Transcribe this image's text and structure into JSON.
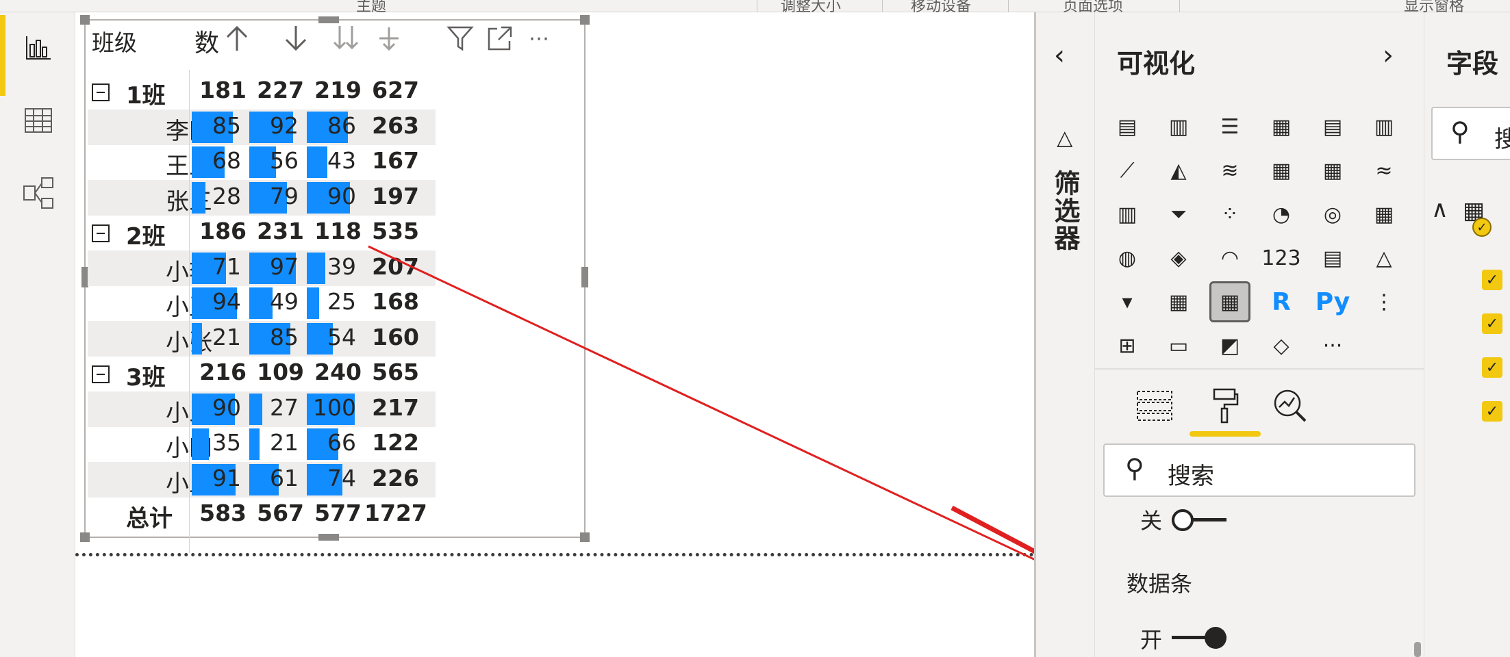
{
  "ribbon": {
    "labels": [
      "主题",
      "调整大小",
      "移动设备",
      "页面选项",
      "显示窗格"
    ]
  },
  "left_nav": {
    "items": [
      {
        "name": "report-view",
        "icon": "bar-chart-icon",
        "active": true
      },
      {
        "name": "data-view",
        "icon": "table-grid-icon",
        "active": false
      },
      {
        "name": "model-view",
        "icon": "model-icon",
        "active": false
      }
    ]
  },
  "matrix": {
    "header": {
      "class_col": "班级",
      "cut_col": "数"
    },
    "groups": [
      {
        "name": "1班",
        "totals": [
          "181",
          "227",
          "219",
          "627"
        ],
        "rows": [
          {
            "name": "李四",
            "values": [
              85,
              92,
              86
            ],
            "total": "263"
          },
          {
            "name": "王五",
            "values": [
              68,
              56,
              43
            ],
            "total": "167"
          },
          {
            "name": "张三",
            "values": [
              28,
              79,
              90
            ],
            "total": "197"
          }
        ]
      },
      {
        "name": "2班",
        "totals": [
          "186",
          "231",
          "118",
          "535"
        ],
        "rows": [
          {
            "name": "小李",
            "values": [
              71,
              97,
              39
            ],
            "total": "207"
          },
          {
            "name": "小王",
            "values": [
              94,
              49,
              25
            ],
            "total": "168"
          },
          {
            "name": "小张",
            "values": [
              21,
              85,
              54
            ],
            "total": "160"
          }
        ]
      },
      {
        "name": "3班",
        "totals": [
          "216",
          "109",
          "240",
          "565"
        ],
        "rows": [
          {
            "name": "小三",
            "values": [
              90,
              27,
              100
            ],
            "total": "217"
          },
          {
            "name": "小四",
            "values": [
              35,
              21,
              66
            ],
            "total": "122"
          },
          {
            "name": "小五",
            "values": [
              91,
              61,
              74
            ],
            "total": "226"
          }
        ]
      }
    ],
    "grand_total": {
      "label": "总计",
      "values": [
        "583",
        "567",
        "577",
        "1727"
      ]
    },
    "data_bar_color": "#118dff",
    "data_bar_max": 100
  },
  "filter_pane": {
    "label": "筛选器"
  },
  "viz_pane": {
    "title": "可视化",
    "search_placeholder": "搜索",
    "toggle_off_label": "关",
    "section_title": "数据条",
    "toggle_on_label": "开",
    "icons": [
      {
        "name": "stacked-bar-icon",
        "g": "▤"
      },
      {
        "name": "stacked-column-icon",
        "g": "▥"
      },
      {
        "name": "clustered-bar-icon",
        "g": "☰"
      },
      {
        "name": "clustered-column-icon",
        "g": "▦"
      },
      {
        "name": "100-stacked-bar-icon",
        "g": "▤"
      },
      {
        "name": "100-stacked-column-icon",
        "g": "▥"
      },
      {
        "name": "line-chart-icon",
        "g": "⟋"
      },
      {
        "name": "area-chart-icon",
        "g": "◭"
      },
      {
        "name": "stacked-area-icon",
        "g": "≋"
      },
      {
        "name": "line-column-icon",
        "g": "▦"
      },
      {
        "name": "line-clustered-column-icon",
        "g": "▦"
      },
      {
        "name": "ribbon-chart-icon",
        "g": "≈"
      },
      {
        "name": "waterfall-icon",
        "g": "▥"
      },
      {
        "name": "funnel-icon",
        "g": "⏷"
      },
      {
        "name": "scatter-icon",
        "g": "⁘"
      },
      {
        "name": "pie-chart-icon",
        "g": "◔"
      },
      {
        "name": "donut-chart-icon",
        "g": "◎"
      },
      {
        "name": "treemap-icon",
        "g": "▦"
      },
      {
        "name": "map-icon",
        "g": "◍"
      },
      {
        "name": "filled-map-icon",
        "g": "◈"
      },
      {
        "name": "gauge-icon",
        "g": "◠"
      },
      {
        "name": "card-icon",
        "g": "123"
      },
      {
        "name": "multirow-card-icon",
        "g": "▤"
      },
      {
        "name": "kpi-icon",
        "g": "△"
      },
      {
        "name": "slicer-icon",
        "g": "▾"
      },
      {
        "name": "table-icon",
        "g": "▦"
      },
      {
        "name": "matrix-icon",
        "g": "▦",
        "selected": true
      },
      {
        "name": "r-visual-icon",
        "g": "R",
        "text": true
      },
      {
        "name": "python-visual-icon",
        "g": "Py",
        "text": true
      },
      {
        "name": "key-influencers-icon",
        "g": "⋮"
      },
      {
        "name": "decomposition-tree-icon",
        "g": "⊞"
      },
      {
        "name": "qa-icon",
        "g": "▭"
      },
      {
        "name": "smart-narrative-icon",
        "g": "◩"
      },
      {
        "name": "power-apps-icon",
        "g": "◇"
      },
      {
        "name": "more-visuals-icon",
        "g": "···"
      }
    ]
  },
  "fields_pane": {
    "title": "字段",
    "search_placeholder": "搜"
  }
}
